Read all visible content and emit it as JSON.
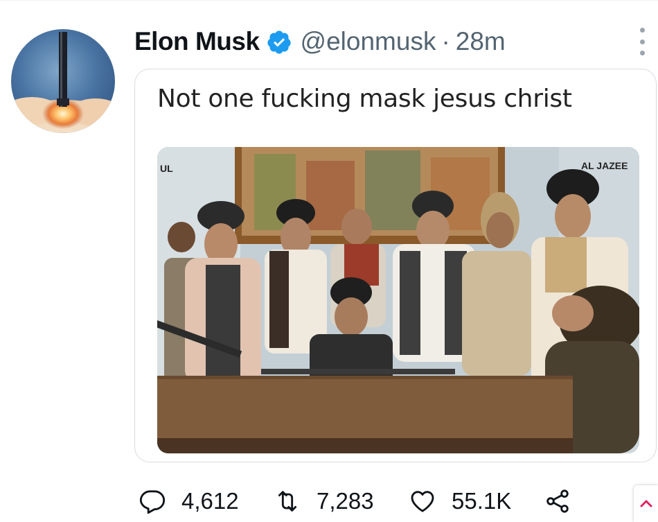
{
  "tweet": {
    "author_name": "Elon Musk",
    "handle": "@elonmusk",
    "separator": "·",
    "time": "28m",
    "text": "Not one fucking mask jesus christ"
  },
  "media": {
    "watermark_left": "UL",
    "watermark_right": "AL JAZEE"
  },
  "actions": {
    "replies": "4,612",
    "retweets": "7,283",
    "likes": "55.1K"
  },
  "icons": {
    "verified": "verified-badge-icon",
    "more": "more-options-icon",
    "reply": "reply-icon",
    "retweet": "retweet-icon",
    "like": "heart-icon",
    "share": "share-icon",
    "scroll_up": "chevron-up-icon"
  },
  "colors": {
    "verified_blue": "#1d9bf0",
    "text_primary": "#0f1419",
    "text_secondary": "#536471",
    "scroll_arrow": "#e0245e"
  }
}
